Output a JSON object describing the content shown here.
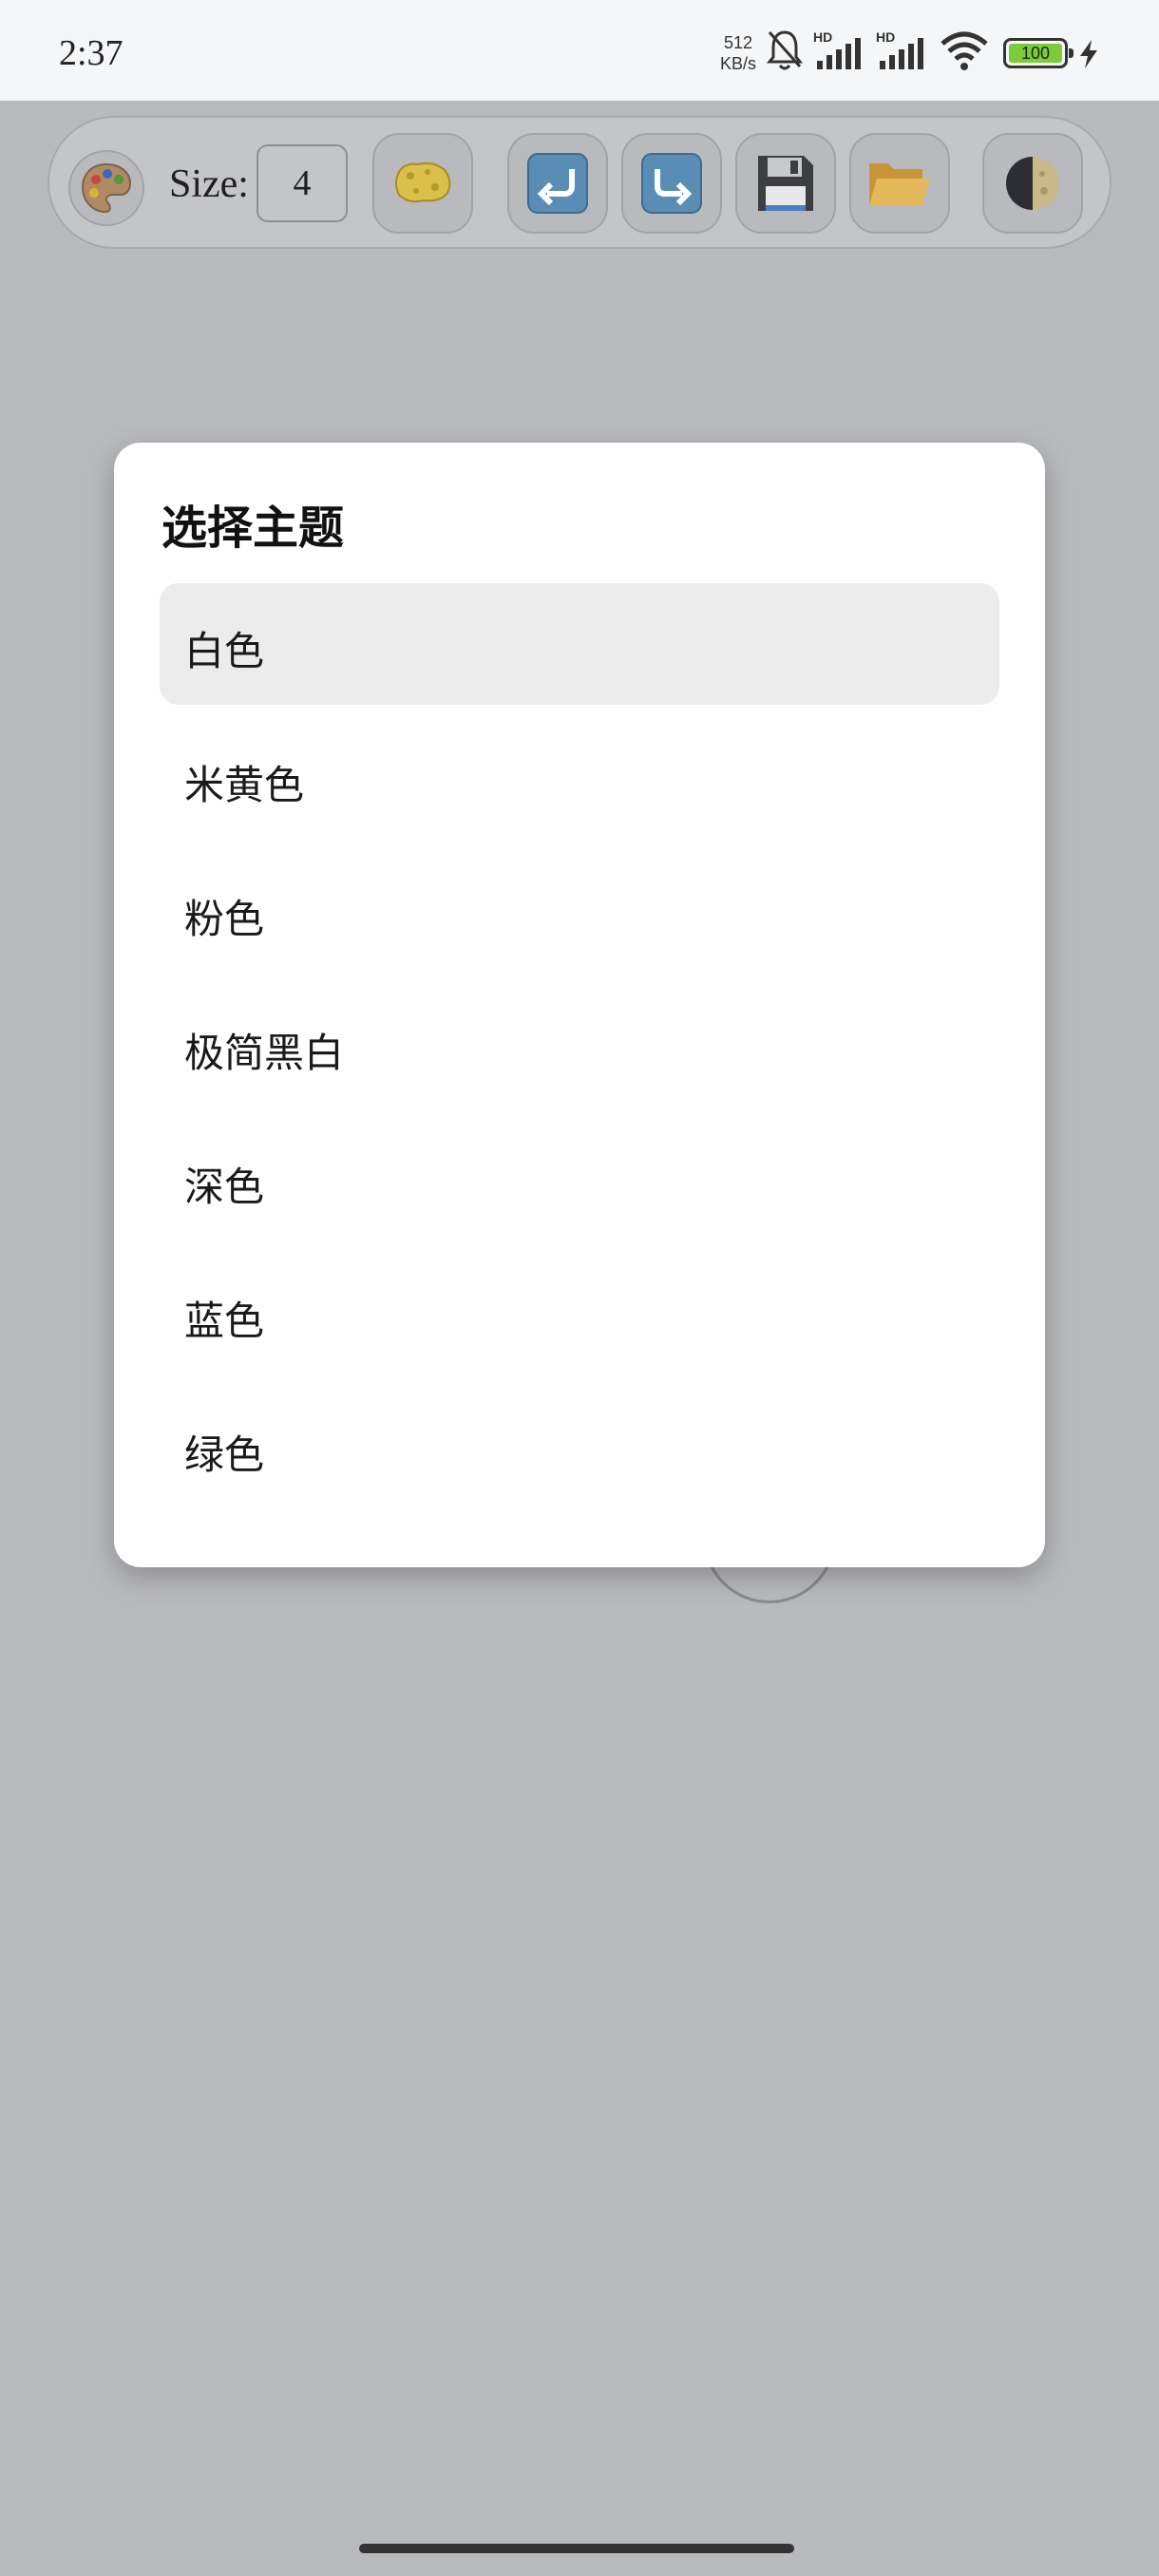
{
  "status_bar": {
    "time": "2:37",
    "net_speed_value": "512",
    "net_speed_unit": "KB/s",
    "battery": "100",
    "icons": [
      "mute-bell-icon",
      "signal-hd-1-icon",
      "signal-hd-2-icon",
      "wifi-icon",
      "battery-icon",
      "charging-icon"
    ]
  },
  "toolbar": {
    "size_label": "Size:",
    "size_value": "4",
    "buttons": [
      "palette-icon",
      "sponge-icon",
      "undo-icon",
      "redo-icon",
      "save-icon",
      "open-folder-icon",
      "theme-moon-icon"
    ]
  },
  "dialog": {
    "title": "选择主题",
    "options": [
      {
        "label": "白色",
        "selected": true
      },
      {
        "label": "米黄色",
        "selected": false
      },
      {
        "label": "粉色",
        "selected": false
      },
      {
        "label": "极简黑白",
        "selected": false
      },
      {
        "label": "深色",
        "selected": false
      },
      {
        "label": "蓝色",
        "selected": false
      },
      {
        "label": "绿色",
        "selected": false
      }
    ]
  },
  "colors": {
    "overlay": "#b9babd",
    "dialog_bg": "#ffffff",
    "selected_bg": "#ececec",
    "battery_fill": "#7ccc3a"
  }
}
